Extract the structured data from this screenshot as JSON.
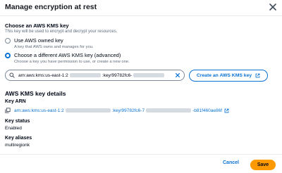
{
  "modal": {
    "title": "Manage encryption at rest"
  },
  "key_section": {
    "label": "Choose an AWS KMS key",
    "description": "This key will be used to encrypt and decrypt your resources.",
    "options": [
      {
        "label": "Use AWS owned key",
        "description": "A key that AWS owns and manages for you.",
        "selected": false
      },
      {
        "label": "Choose a different AWS KMS key (advanced)",
        "description": "Choose a key you have permission to use, or create a new one.",
        "selected": true
      }
    ]
  },
  "key_search": {
    "value_start": "arn:aws:kms:us-east-1:2",
    "value_end": ":key/99782fc6-"
  },
  "create_key_button": {
    "label": "Create an AWS KMS key"
  },
  "details": {
    "title": "AWS KMS key details",
    "arn_label": "Key ARN",
    "arn_start": "arn:aws:kms:us-east-1:2",
    "arn_middle": ":key/99782fc6-7",
    "arn_end": "-b81f460ae86f",
    "status_label": "Key status",
    "status_value": "Enabled",
    "aliases_label": "Key aliases",
    "aliases_value": "multiregionk"
  },
  "footer": {
    "cancel_label": "Cancel",
    "save_label": "Save"
  },
  "colors": {
    "accent": "#0972d3",
    "primary_button": "#ff9900",
    "text": "#000716",
    "secondary_text": "#5f6b7a"
  },
  "icons": {
    "close": "close-icon",
    "search": "search-icon",
    "clear": "clear-icon",
    "external": "external-link-icon",
    "copy": "copy-icon"
  }
}
